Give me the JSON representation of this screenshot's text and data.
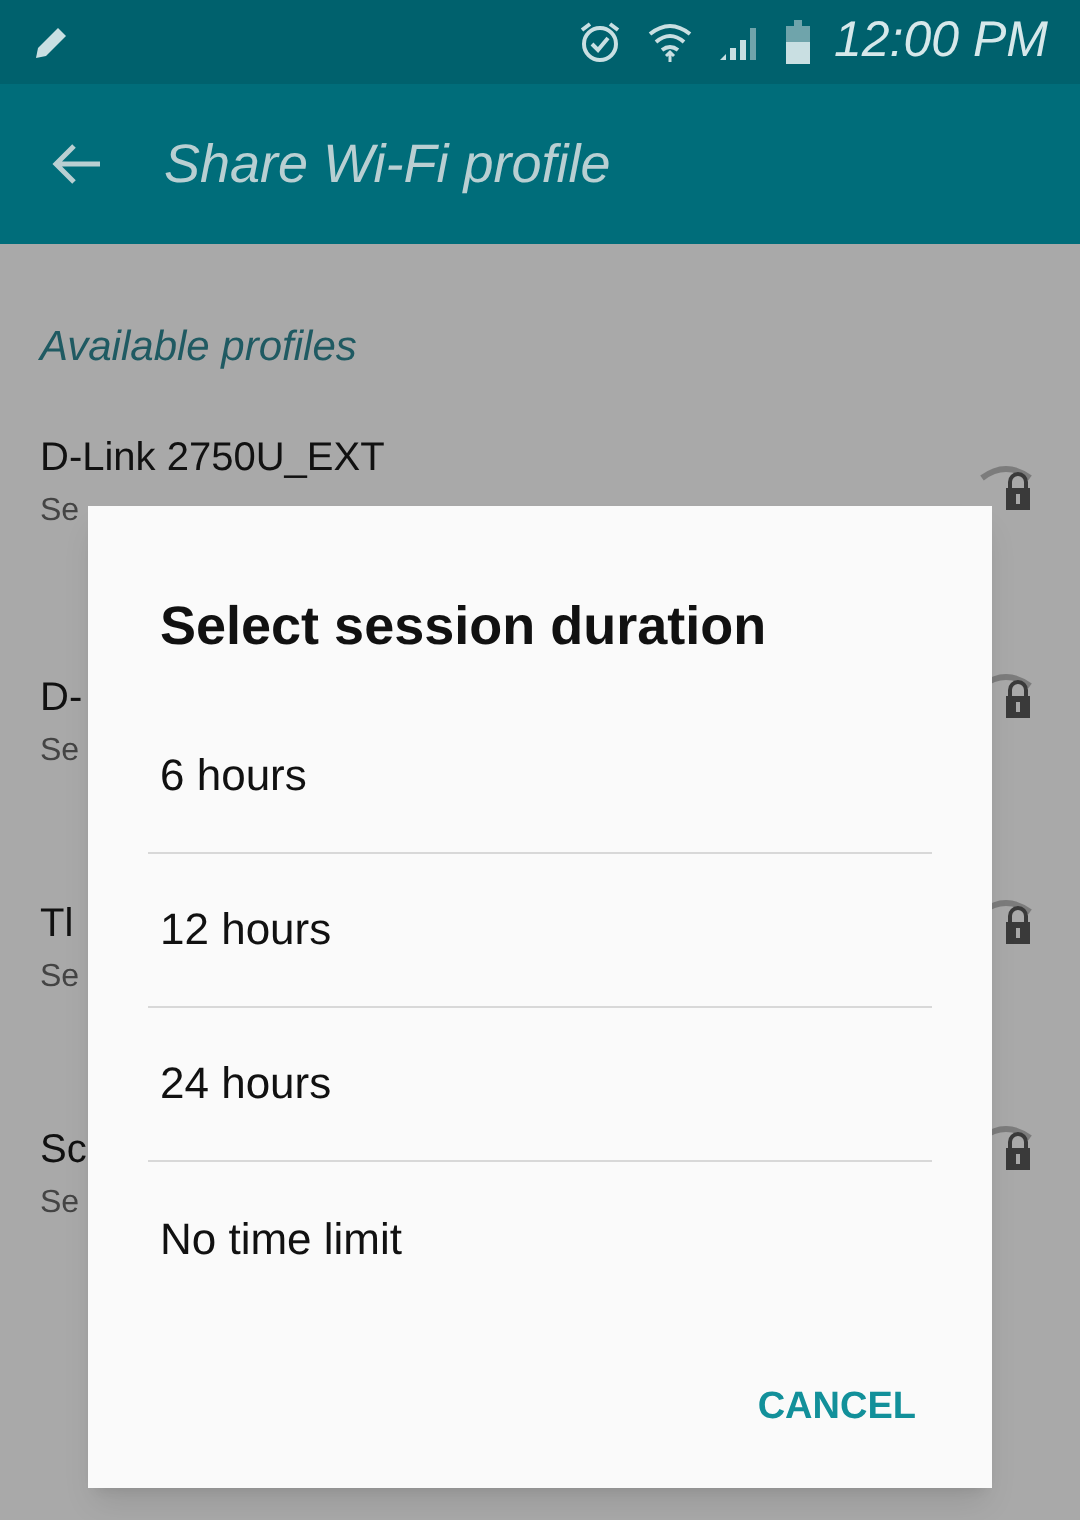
{
  "status_bar": {
    "time": "12:00 PM"
  },
  "app_bar": {
    "title": "Share Wi-Fi profile"
  },
  "section_header": "Available profiles",
  "profiles": [
    {
      "name": "D-Link 2750U_EXT",
      "subtitle": "Se"
    },
    {
      "name": "D-",
      "subtitle": "Se"
    },
    {
      "name": "Tl",
      "subtitle": "Se"
    },
    {
      "name": "Sc",
      "subtitle": "Se"
    }
  ],
  "dialog": {
    "title": "Select session duration",
    "options": [
      "6 hours",
      "12 hours",
      "24 hours",
      "No time limit"
    ],
    "buttons": [
      "CANCEL"
    ]
  }
}
